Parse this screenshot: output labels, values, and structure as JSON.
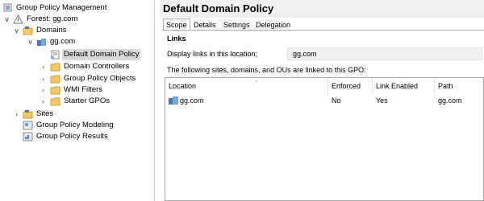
{
  "tree": {
    "root": "Group Policy Management",
    "forest": "Forest: gg.com",
    "domains": "Domains",
    "domain": "gg.com",
    "default_policy": "Default Domain Policy",
    "domain_controllers": "Domain Controllers",
    "gpo": "Group Policy Objects",
    "wmi": "WMI Filters",
    "starter": "Starter GPOs",
    "sites": "Sites",
    "modeling": "Group Policy Modeling",
    "results": "Group Policy Results"
  },
  "pane": {
    "title": "Default Domain Policy",
    "tabs": [
      "Scope",
      "Details",
      "Settings",
      "Delegation"
    ],
    "links_header": "Links",
    "display_links_label": "Display links in this location:",
    "display_links_value": "gg.com",
    "linked_desc": "The following sites, domains, and OUs are linked to this GPO:",
    "columns": [
      "Location",
      "Enforced",
      "Link Enabled",
      "Path"
    ],
    "rows": [
      {
        "location": "gg.com",
        "enforced": "No",
        "link_enabled": "Yes",
        "path": "gg.com"
      }
    ]
  }
}
